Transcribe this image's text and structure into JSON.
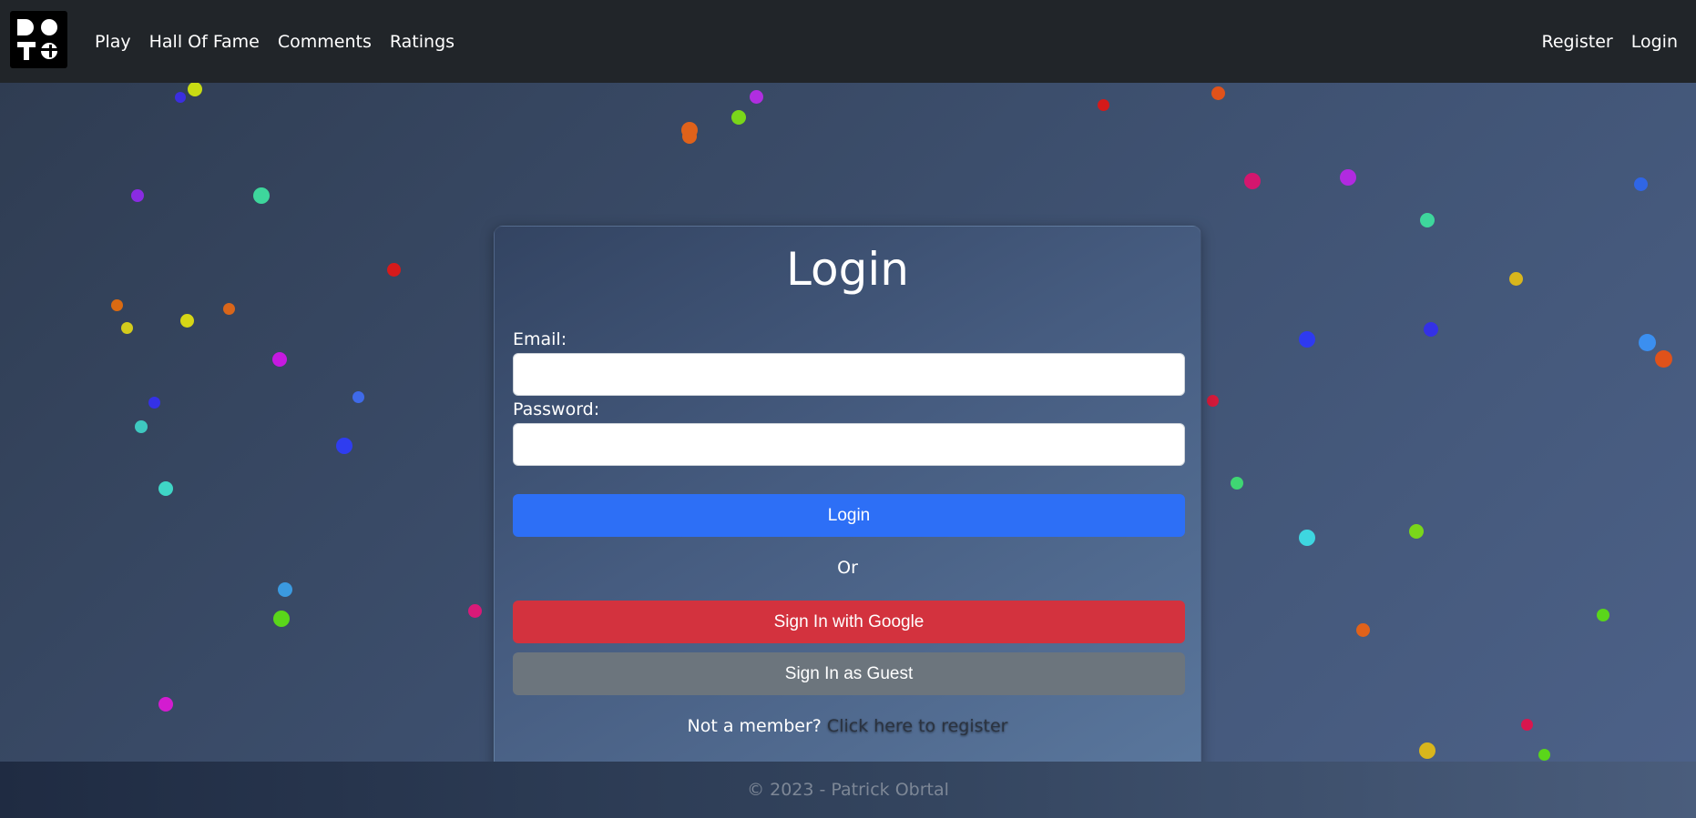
{
  "navbar": {
    "logo_letters": [
      "D",
      "O",
      "T",
      "S"
    ],
    "left_links": [
      "Play",
      "Hall Of Fame",
      "Comments",
      "Ratings"
    ],
    "right_links": [
      "Register",
      "Login"
    ]
  },
  "login": {
    "title": "Login",
    "email_label": "Email:",
    "email_value": "",
    "password_label": "Password:",
    "password_value": "",
    "submit_label": "Login",
    "or_text": "Or",
    "google_label": "Sign In with Google",
    "guest_label": "Sign In as Guest",
    "register_prompt": "Not a member?",
    "register_link": "Click here to register"
  },
  "footer": {
    "text": "© 2023 - Patrick Obrtal"
  },
  "colors": {
    "navbar_bg": "#212529",
    "primary": "#2d6ff6",
    "danger": "#d3323e",
    "secondary": "#6c757d"
  }
}
